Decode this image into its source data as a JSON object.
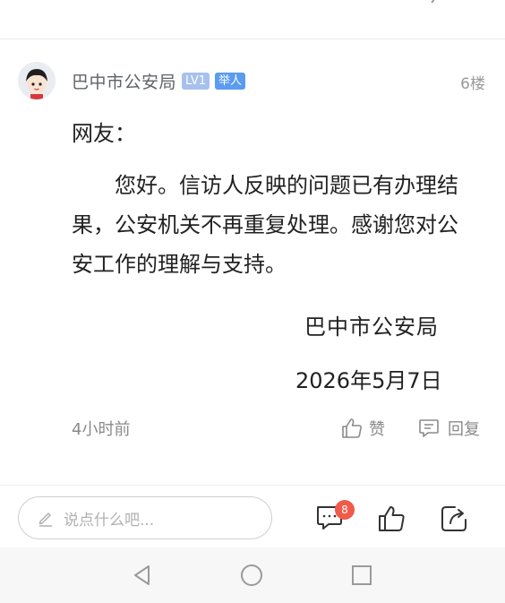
{
  "post": {
    "author": "巴中市公安局",
    "level_badge": "LV1",
    "role_badge": "举人",
    "floor": "6楼",
    "greeting": "网友：",
    "body": "您好。信访人反映的问题已有办理结果，公安机关不再重复处理。感谢您对公安工作的理解与支持。",
    "signature_org": "巴中市公安局",
    "signature_date": "2026年5月7日",
    "time": "4小时前",
    "like_label": "赞",
    "reply_label": "回复"
  },
  "bottom_bar": {
    "comment_placeholder": "说点什么吧...",
    "comment_count": "8"
  },
  "colors": {
    "accent_blue": "#5b9bf0",
    "level_badge": "#a7c1ec",
    "notification_red": "#f05a4a",
    "muted_text": "#8a8a8a"
  },
  "icons": {
    "avatar": "cartoon-avatar",
    "like": "thumbs-up-icon",
    "reply": "speech-bubble-icon",
    "comments": "comments-icon",
    "share": "share-icon",
    "nav_back": "triangle-back-icon",
    "nav_home": "circle-home-icon",
    "nav_recent": "square-recent-icon"
  }
}
